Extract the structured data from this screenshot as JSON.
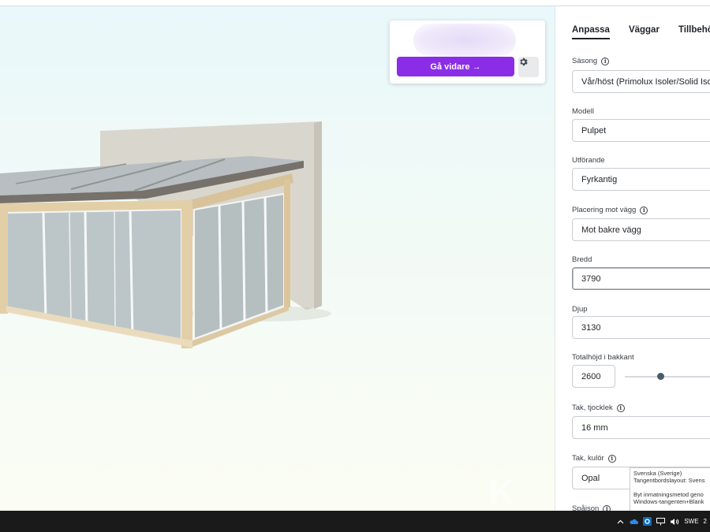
{
  "primary_button": "Gå vidare →",
  "tabs": [
    {
      "label": "Anpassa",
      "active": true
    },
    {
      "label": "Väggar",
      "active": false
    },
    {
      "label": "Tillbehör",
      "active": false
    }
  ],
  "fields": {
    "sasong": {
      "label": "Säsong",
      "value": "Vår/höst (Primolux Isoler/Solid Isol"
    },
    "modell": {
      "label": "Modell",
      "value": "Pulpet"
    },
    "utforande": {
      "label": "Utförande",
      "value": "Fyrkantig"
    },
    "placering": {
      "label": "Placering mot vägg",
      "value": "Mot bakre vägg"
    },
    "bredd": {
      "label": "Bredd",
      "value": "3790"
    },
    "djup": {
      "label": "Djup",
      "value": "3130"
    },
    "totalhojd": {
      "label": "Totalhöjd i bakkant",
      "value": "2600"
    },
    "tak_tjocklek": {
      "label": "Tak, tjocklek",
      "value": "16 mm"
    },
    "tak_kulor": {
      "label": "Tak, kulör",
      "value": "Opal"
    },
    "spajson": {
      "label": "Spåjson"
    }
  },
  "tooltip": {
    "line1": "Svenska (Sverige)",
    "line2": "Tangentbordslayout: Svens",
    "line3": "Byt inmatningsmetod geno",
    "line4": "Windows-tangenten+Blank"
  },
  "taskbar": {
    "language": "SWE",
    "clock": "2"
  },
  "watermark": "K",
  "colors": {
    "accent": "#8b2ce6",
    "panel_border": "#c9cdd2",
    "taskbar": "#1a1a1a"
  }
}
